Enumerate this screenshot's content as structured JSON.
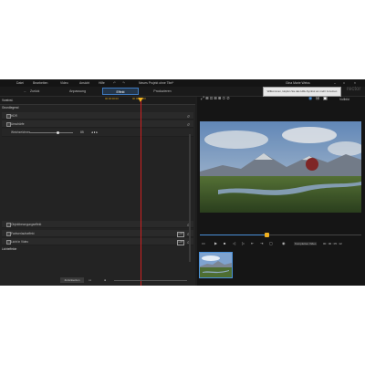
{
  "menu": {
    "items": [
      "Datei",
      "Bearbeiten",
      "Video",
      "Ansicht",
      "Hilfe"
    ],
    "project_title": "Neues Projekt ohne Titel*",
    "user": "Gina Marie Weiss",
    "brand": "rector"
  },
  "tabs": {
    "back": "Zurück",
    "items": [
      {
        "label": "Anpassung",
        "active": false
      },
      {
        "label": "Effekt",
        "active": true
      },
      {
        "label": "Produzieren",
        "active": false
      }
    ]
  },
  "ruler": {
    "ticks": [
      "00:00:00:00",
      "00:00:10:00"
    ]
  },
  "left": {
    "section_top": "Voreinst.",
    "group_label": "Grundlegend",
    "rows": [
      {
        "label": "HDR",
        "checked": true
      },
      {
        "label": "Unschärfe",
        "checked": true
      },
      {
        "label": "Weichzeichner",
        "checked": false,
        "value": "85"
      },
      {
        "label": "Objektbewegungseffekt",
        "checked": true
      },
      {
        "label": "Farbverlaufseffekt",
        "checked": true
      },
      {
        "label": "Licht in Video",
        "checked": true
      }
    ],
    "section_bottom": "Lichteffekte",
    "apply_button": "Zurücksetzen",
    "slider_value": "85"
  },
  "right": {
    "tooltip": "Willkommen, klopfen Sie das Hilfe-Symbol um mehr zu lernen",
    "view_option": "Vollbild",
    "time_option": "Komplettes Video",
    "timecode": "00 : 00 : 05 : 12",
    "progress_fraction": 0.41
  },
  "colors": {
    "accent": "#4a90d9",
    "playhead": "#d02020",
    "marker": "#f0b020"
  }
}
